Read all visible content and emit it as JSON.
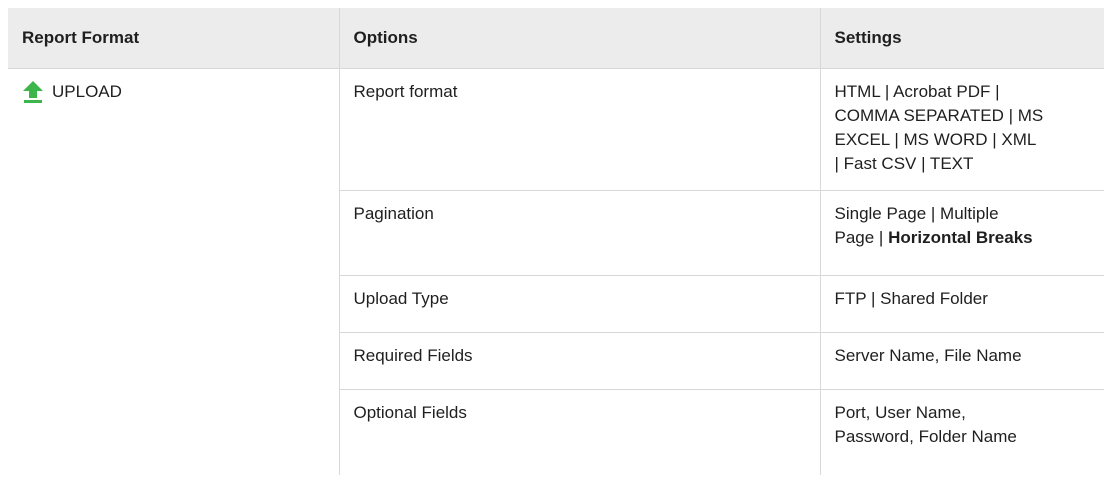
{
  "table": {
    "headers": [
      "Report Format",
      "Options",
      "Settings"
    ],
    "format": {
      "label": "UPLOAD",
      "icon": "upload-arrow-icon",
      "icon_color": "#3cb54a"
    },
    "rows": [
      {
        "option": "Report format",
        "setting_lines": [
          "HTML | Acrobat PDF |",
          "COMMA SEPARATED | MS",
          "EXCEL | MS WORD | XML",
          "| Fast CSV | TEXT"
        ]
      },
      {
        "option": "Pagination",
        "setting_lines": [
          "Single Page | Multiple",
          "Page | "
        ],
        "setting_bold": "Horizontal Breaks"
      },
      {
        "option": "Upload Type",
        "setting_lines": [
          "FTP | Shared Folder"
        ]
      },
      {
        "option": "Required Fields",
        "setting_lines": [
          "Server Name, File Name"
        ]
      },
      {
        "option": "Optional Fields",
        "setting_lines": [
          "Port, User Name,",
          "Password, Folder Name"
        ]
      }
    ]
  }
}
